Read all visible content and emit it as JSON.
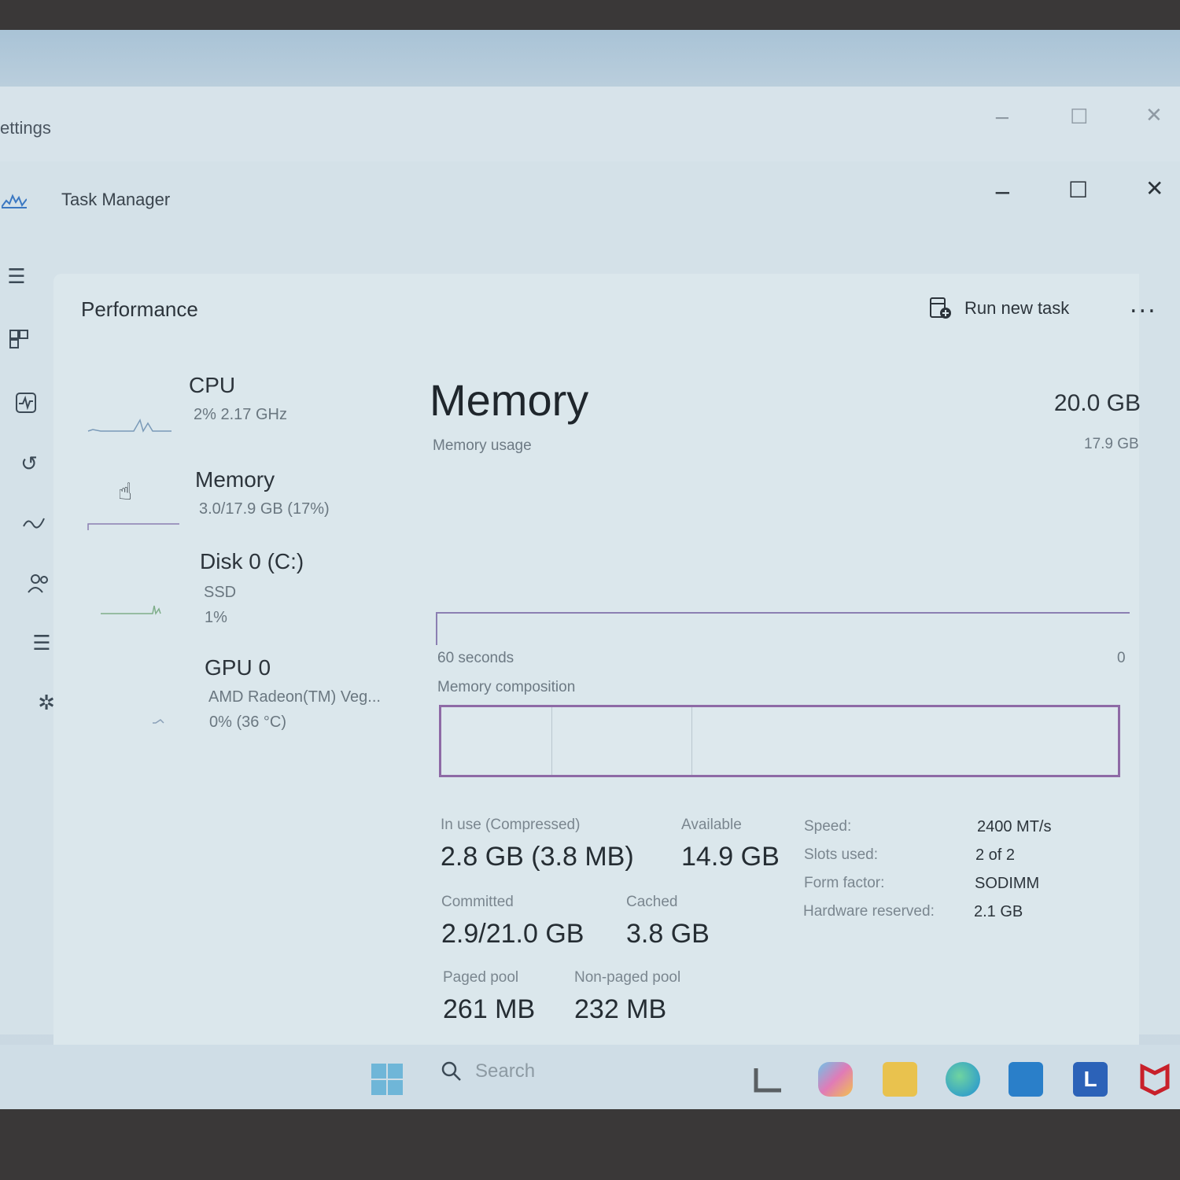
{
  "background_window": {
    "title": "ettings",
    "minimize_icon": "minimize-icon",
    "maximize_icon": "maximize-icon",
    "close_icon": "close-icon"
  },
  "window": {
    "title": "Task Manager",
    "app_icon": "task-manager-icon"
  },
  "nav": {
    "items": [
      {
        "icon": "hamburger-menu-icon",
        "name": "menu"
      },
      {
        "icon": "processes-icon",
        "name": "processes"
      },
      {
        "icon": "performance-icon",
        "name": "performance"
      },
      {
        "icon": "app-history-icon",
        "name": "app-history"
      },
      {
        "icon": "startup-apps-icon",
        "name": "startup-apps"
      },
      {
        "icon": "users-icon",
        "name": "users"
      },
      {
        "icon": "details-icon",
        "name": "details"
      },
      {
        "icon": "services-icon",
        "name": "services"
      },
      {
        "icon": "settings-icon",
        "name": "settings"
      }
    ]
  },
  "header": {
    "title": "Performance",
    "run_new_task": "Run new task",
    "more": "..."
  },
  "devices": [
    {
      "name": "CPU",
      "line1": "2%  2.17 GHz",
      "line2": ""
    },
    {
      "name": "Memory",
      "line1": "3.0/17.9 GB (17%)",
      "line2": ""
    },
    {
      "name": "Disk 0 (C:)",
      "line1": "SSD",
      "line2": "1%"
    },
    {
      "name": "GPU 0",
      "line1": "AMD Radeon(TM) Veg...",
      "line2": "0%  (36 °C)"
    }
  ],
  "detail": {
    "title": "Memory",
    "total": "20.0 GB",
    "usage_label": "Memory usage",
    "usage_max": "17.9 GB",
    "time_label": "60 seconds",
    "time_end": "0",
    "composition_label": "Memory composition",
    "stats": {
      "in_use_label": "In use (Compressed)",
      "in_use": "2.8 GB (3.8 MB)",
      "available_label": "Available",
      "available": "14.9 GB",
      "committed_label": "Committed",
      "committed": "2.9/21.0 GB",
      "cached_label": "Cached",
      "cached": "3.8 GB",
      "paged_pool_label": "Paged pool",
      "paged_pool": "261 MB",
      "non_paged_pool_label": "Non-paged pool",
      "non_paged_pool": "232 MB"
    },
    "properties": {
      "speed_label": "Speed:",
      "speed": "2400 MT/s",
      "slots_label": "Slots used:",
      "slots": "2 of 2",
      "form_label": "Form factor:",
      "form": "SODIMM",
      "hw_label": "Hardware reserved:",
      "hw": "2.1 GB"
    }
  },
  "taskbar": {
    "search_placeholder": "Search",
    "apps": [
      "start-icon",
      "search-icon",
      "widgets-icon",
      "copilot-icon",
      "file-explorer-icon",
      "edge-icon",
      "store-icon",
      "l-app-icon",
      "mcafee-icon"
    ]
  },
  "colors": {
    "accent": "#8e6aa6",
    "graph_line": "#8b7fb2"
  }
}
